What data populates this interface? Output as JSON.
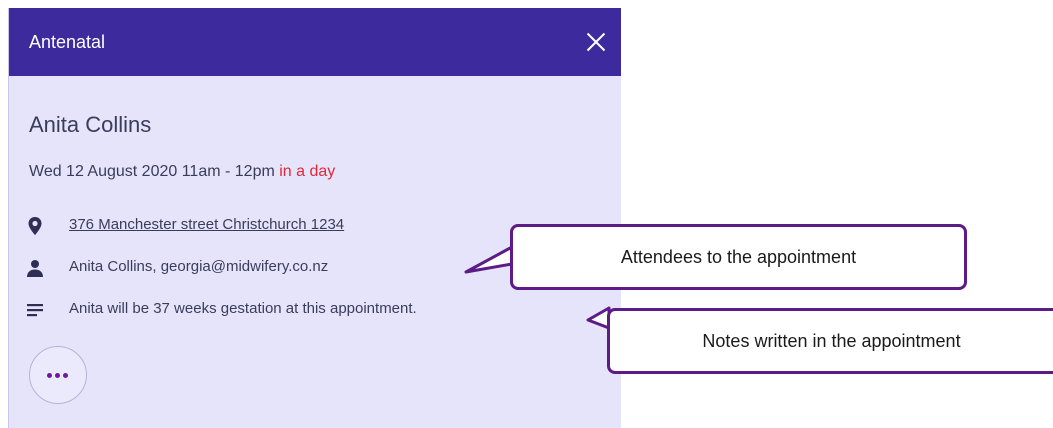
{
  "header": {
    "title": "Antenatal"
  },
  "appointment": {
    "patient_name": "Anita Collins",
    "datetime": "Wed 12 August 2020 11am - 12pm",
    "relative_time": "in a day",
    "address": "376 Manchester street Christchurch 1234",
    "attendees": "Anita Collins, georgia@midwifery.co.nz",
    "notes": "Anita will be 37 weeks gestation at this appointment."
  },
  "callouts": {
    "attendees": "Attendees to the appointment",
    "notes": "Notes written in the appointment"
  },
  "colors": {
    "header_bg": "#3d2a9d",
    "panel_bg": "#e6e4fb",
    "relative_time": "#e0283a",
    "callout_border": "#5c1b86"
  },
  "icons": [
    "close-icon",
    "location-pin-icon",
    "person-icon",
    "notes-icon",
    "more-icon"
  ]
}
